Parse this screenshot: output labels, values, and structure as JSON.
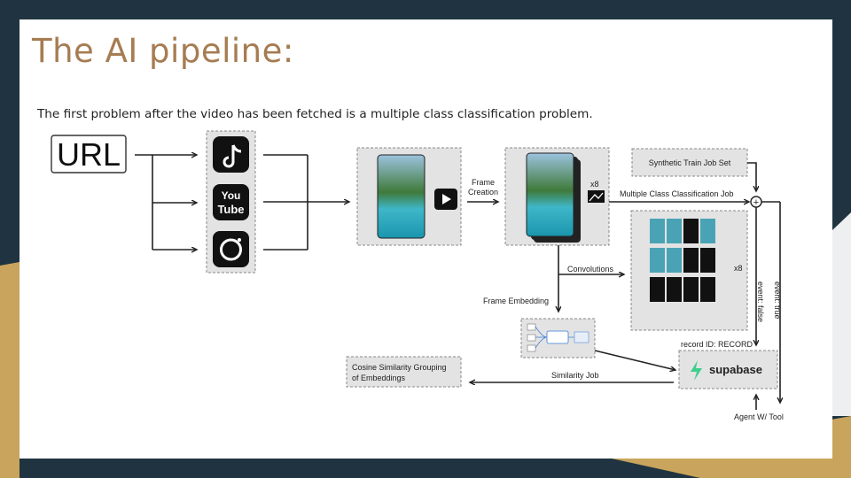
{
  "slide": {
    "title": "The AI pipeline:",
    "subtitle": "The first problem after the video has been fetched is a multiple class classification problem."
  },
  "diagram": {
    "url_label": "URL",
    "icons": [
      "tiktok-icon",
      "youtube-icon",
      "instagram-icon",
      "play-icon",
      "image-icon",
      "supabase-logo-icon"
    ],
    "youtube_text_1": "You",
    "youtube_text_2": "Tube",
    "frame_creation_1": "Frame",
    "frame_creation_2": "Creation",
    "x8_top": "x8",
    "x8_grid": "x8",
    "synthetic_train": "Synthetic Train Job Set",
    "multi_class_job": "Multiple Class Classification Job",
    "convolutions": "Convolutions",
    "frame_embedding": "Frame Embedding",
    "event_false": "event: false",
    "event_true": "event: true",
    "record_id": "record ID: RECORD",
    "supabase": "supabase",
    "similarity_job": "Similarity Job",
    "cosine_1": "Cosine Similarity Grouping",
    "cosine_2": "of Embeddings",
    "agent_tool": "Agent W/ Tool",
    "plus": "+"
  },
  "colors": {
    "background": "#1f3440",
    "accent_gold": "#c9a45c",
    "title": "#a67c52",
    "supabase_green": "#3ecf8e"
  }
}
